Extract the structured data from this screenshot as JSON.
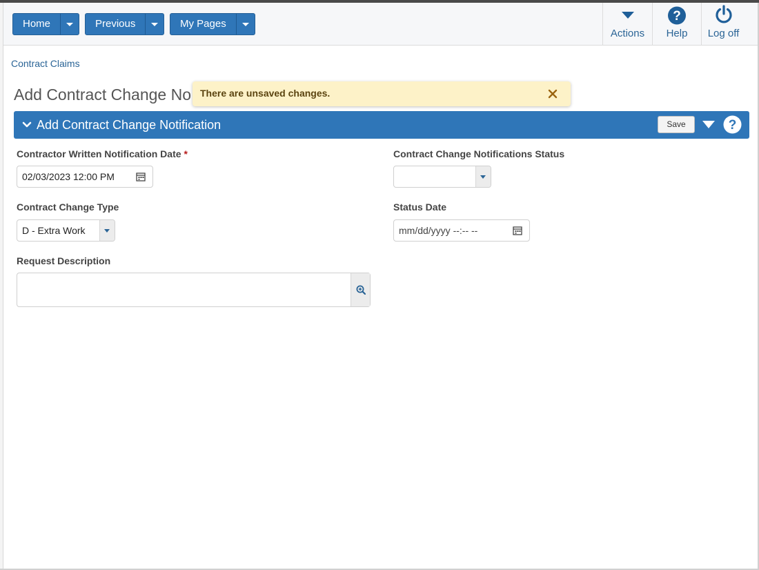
{
  "header": {
    "home_label": "Home",
    "previous_label": "Previous",
    "mypages_label": "My Pages",
    "actions_label": "Actions",
    "help_label": "Help",
    "logoff_label": "Log off"
  },
  "breadcrumb": "Contract Claims",
  "page_title": "Add Contract Change No",
  "toast": {
    "message": "There are unsaved changes."
  },
  "panel": {
    "title": "Add Contract Change Notification",
    "save_label": "Save"
  },
  "form": {
    "notification_date": {
      "label": "Contractor Written Notification Date",
      "required": "*",
      "value": "02/03/2023 12:00 PM"
    },
    "status": {
      "label": "Contract Change Notifications Status",
      "value": ""
    },
    "change_type": {
      "label": "Contract Change Type",
      "value": "D - Extra Work"
    },
    "status_date": {
      "label": "Status Date",
      "placeholder": "mm/dd/yyyy --:-- --"
    },
    "request_description": {
      "label": "Request Description",
      "value": ""
    }
  },
  "colors": {
    "primary_blue": "#2f76b8",
    "link_blue": "#2a6496",
    "toast_bg": "#fdf2c8",
    "required_red": "#b71c1c"
  }
}
